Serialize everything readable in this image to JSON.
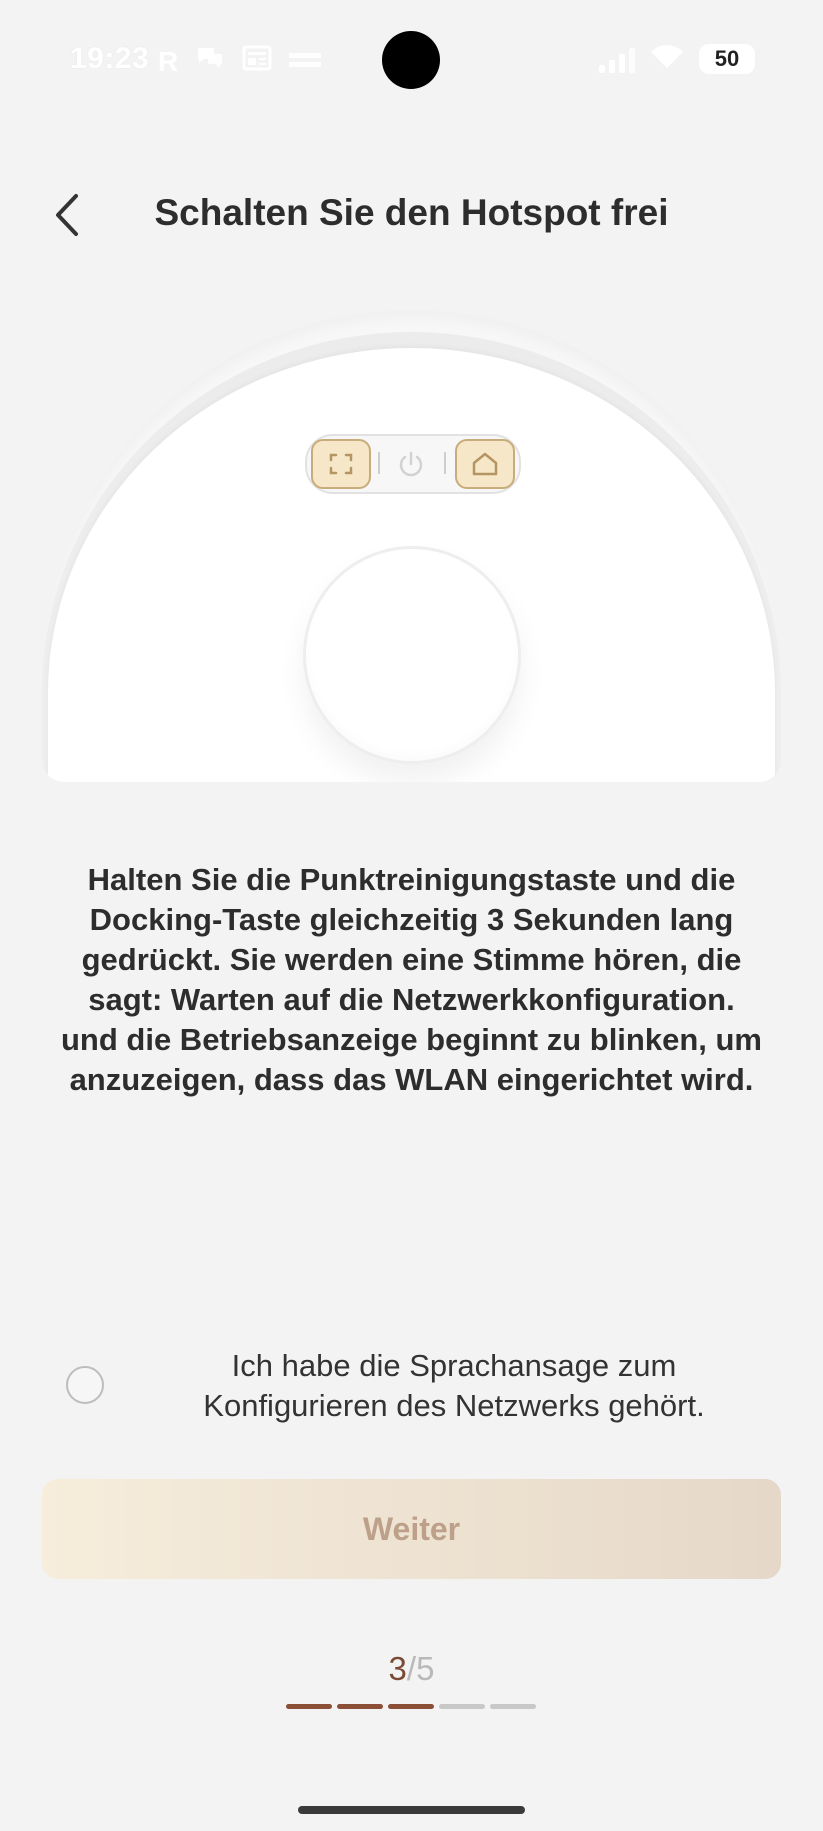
{
  "status_bar": {
    "time": "19:23",
    "left_icons": [
      "r-icon",
      "chat-icon",
      "news-icon",
      "media-icon"
    ],
    "battery": "50"
  },
  "header": {
    "back_icon": "chevron-left-icon",
    "title": "Schalten Sie den Hotspot frei"
  },
  "device": {
    "buttons": [
      "spot-clean-icon",
      "power-icon",
      "home-icon"
    ],
    "highlight_color": "#f5e7c8",
    "highlight_border": "#c9ac7b"
  },
  "instructions": "Halten Sie die Punktreinigungstaste und die Docking-Taste gleichzeitig 3 Sekunden lang gedrückt. Sie werden eine Stimme hören, die sagt: Warten auf die Netzwerkkonfiguration. und die Betriebsanzeige beginnt zu blinken, um anzuzeigen, dass das WLAN eingerichtet wird.",
  "confirm": {
    "checked": false,
    "label": "Ich habe die Sprachansage zum Konfigurieren des Netzwerks gehört."
  },
  "next_button": {
    "label": "Weiter"
  },
  "progress": {
    "current": "3",
    "separator": "/",
    "total": "5",
    "completed_steps": 3,
    "total_steps": 5,
    "active_color": "#8b4e36",
    "inactive_color": "#c8c8c8"
  },
  "colors": {
    "background": "#f3f3f3",
    "button_gradient_start": "#f6eddb",
    "button_gradient_end": "#e6d8c8",
    "button_text": "#bca08a"
  }
}
